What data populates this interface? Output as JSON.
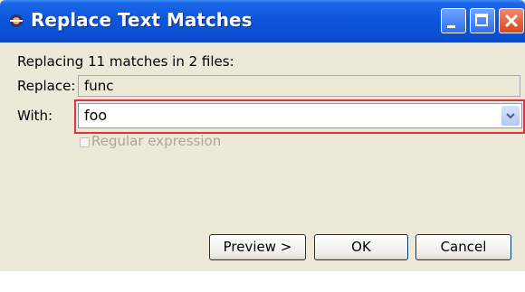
{
  "window": {
    "title": "Replace Text Matches"
  },
  "titlebar_icons": {
    "app": "eclipse-icon",
    "minimize": "minimize-icon",
    "maximize": "maximize-icon",
    "close": "close-icon"
  },
  "dialog": {
    "summary": "Replacing 11 matches in 2 files:",
    "replace_label": "Replace:",
    "replace_value": "func",
    "with_label": "With:",
    "with_value": "foo",
    "regex_label": "Regular expression",
    "regex_checked": false
  },
  "buttons": {
    "preview": "Preview >",
    "ok": "OK",
    "cancel": "Cancel"
  },
  "colors": {
    "titlebar": "#0a4fd2",
    "highlight_border": "#e0343a",
    "close_button": "#d9461e"
  }
}
